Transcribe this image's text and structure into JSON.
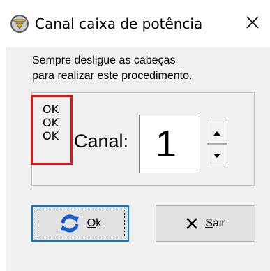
{
  "window": {
    "title": "Canal caixa de potência"
  },
  "instructions": [
    "Sempre desligue as cabeças",
    "para realizar este procedimento."
  ],
  "status_lines": [
    "OK",
    "OK",
    "OK"
  ],
  "channel": {
    "label": "Canal:",
    "value": "1"
  },
  "buttons": {
    "ok": {
      "mnemonic": "O",
      "rest": "k"
    },
    "sair": {
      "mnemonic": "S",
      "rest": "air"
    }
  },
  "colors": {
    "status_box_border": "#e3140f",
    "ok_icon": "#1559c9",
    "focus_border": "#0078d7"
  },
  "icons": {
    "title": "app-icon",
    "close": "close-icon",
    "ok": "refresh-icon",
    "sair": "x-icon",
    "spin_up": "arrow-up-icon",
    "spin_down": "arrow-down-icon"
  }
}
